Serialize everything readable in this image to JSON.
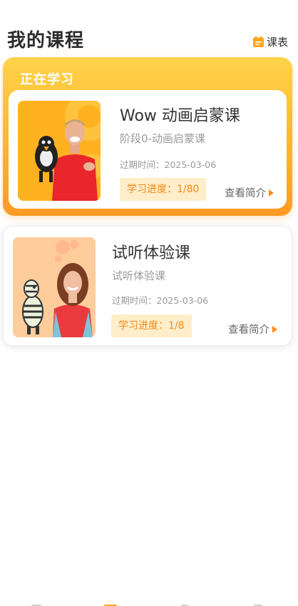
{
  "header": {
    "title": "我的课程",
    "schedule_label": "课表",
    "schedule_icon": "calendar-icon"
  },
  "colors": {
    "accent": "#ffb52e",
    "accent_dark": "#ff9a24",
    "badge_bg": "#ffeec9",
    "badge_text": "#f08a1c",
    "arrow": "#ff8b1f"
  },
  "current": {
    "section_label": "正在学习",
    "course": {
      "title": "Wow 动画启蒙课",
      "subtitle": "阶段0-动画启蒙课",
      "expiry": "过期时间：2025-03-06",
      "progress_label": "学习进度：1/80",
      "progress_done": 1,
      "progress_total": 80,
      "intro_label": "查看简介",
      "thumbnail": "teacher-with-puppet-image"
    }
  },
  "courses": [
    {
      "title": "试听体验课",
      "subtitle": "试听体验课",
      "expiry": "过期时间：2025-03-06",
      "progress_label": "学习进度：1/8",
      "progress_done": 1,
      "progress_total": 8,
      "intro_label": "查看简介",
      "thumbnail": "teacher-with-zebra-image"
    }
  ]
}
